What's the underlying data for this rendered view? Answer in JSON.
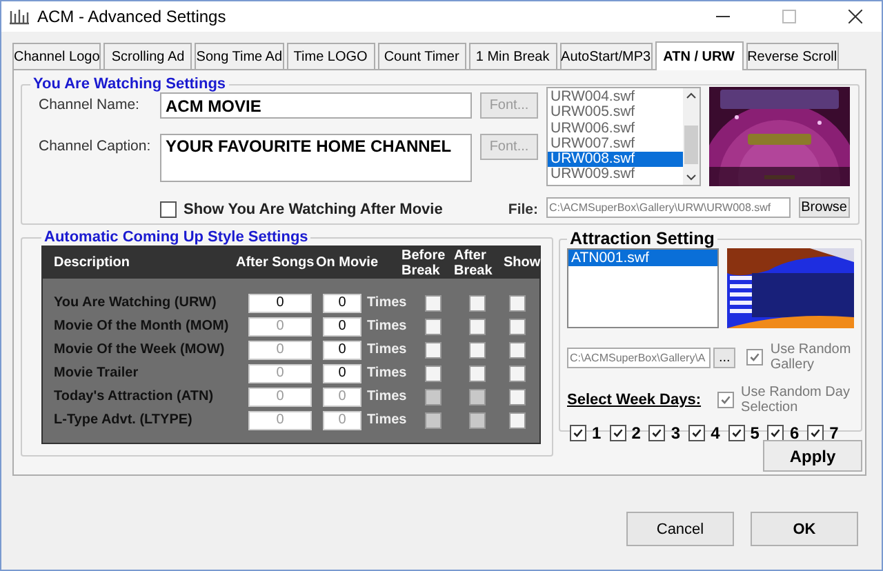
{
  "window": {
    "title": "ACM - Advanced Settings"
  },
  "tabs": [
    {
      "label": "Channel Logo",
      "selected": false
    },
    {
      "label": "Scrolling Ad",
      "selected": false
    },
    {
      "label": "Song Time Ad",
      "selected": false
    },
    {
      "label": "Time LOGO",
      "selected": false
    },
    {
      "label": "Count Timer",
      "selected": false
    },
    {
      "label": "1 Min Break",
      "selected": false
    },
    {
      "label": "AutoStart/MP3",
      "selected": false
    },
    {
      "label": "ATN / URW",
      "selected": true
    },
    {
      "label": "Reverse Scroll",
      "selected": false
    }
  ],
  "watching": {
    "title": "You Are Watching Settings",
    "channel_name": {
      "label": "Channel Name:",
      "value": "ACM MOVIE"
    },
    "channel_caption": {
      "label": "Channel Caption:",
      "value": "YOUR FAVOURITE HOME CHANNEL"
    },
    "font_buttons": [
      {
        "label": "Font...",
        "disabled": true
      },
      {
        "label": "Font...",
        "disabled": true
      }
    ],
    "show_after_movie": {
      "label": "Show You Are Watching After Movie",
      "checked": false
    },
    "files": [
      {
        "name": "URW004.swf",
        "selected": false
      },
      {
        "name": "URW005.swf",
        "selected": false
      },
      {
        "name": "URW006.swf",
        "selected": false
      },
      {
        "name": "URW007.swf",
        "selected": false
      },
      {
        "name": "URW008.swf",
        "selected": true
      },
      {
        "name": "URW009.swf",
        "selected": false
      }
    ],
    "file": {
      "label": "File:",
      "value": "C:\\ACMSuperBox\\Gallery\\URW\\URW008.swf",
      "disabled": true
    },
    "browse": "Browse"
  },
  "coming_up": {
    "title": "Automatic Coming Up Style Settings",
    "columns": [
      "Description",
      "After Songs",
      "On Movie",
      "Before Break",
      "After Break",
      "Show"
    ],
    "rows": [
      {
        "description": "You Are Watching (URW)",
        "after_songs": {
          "value": "0",
          "disabled": false
        },
        "on_movie": {
          "value": "0",
          "disabled": false
        },
        "unit": "Times",
        "before_break": {
          "checked": false,
          "disabled": false
        },
        "after_break": {
          "checked": false,
          "disabled": false
        },
        "show": {
          "checked": false,
          "disabled": false
        }
      },
      {
        "description": "Movie Of the Month (MOM)",
        "after_songs": {
          "value": "0",
          "disabled": true
        },
        "on_movie": {
          "value": "0",
          "disabled": false
        },
        "unit": "Times",
        "before_break": {
          "checked": false,
          "disabled": false
        },
        "after_break": {
          "checked": false,
          "disabled": false
        },
        "show": {
          "checked": false,
          "disabled": false
        }
      },
      {
        "description": "Movie Of the Week (MOW)",
        "after_songs": {
          "value": "0",
          "disabled": true
        },
        "on_movie": {
          "value": "0",
          "disabled": false
        },
        "unit": "Times",
        "before_break": {
          "checked": false,
          "disabled": false
        },
        "after_break": {
          "checked": false,
          "disabled": false
        },
        "show": {
          "checked": false,
          "disabled": false
        }
      },
      {
        "description": "Movie Trailer",
        "after_songs": {
          "value": "0",
          "disabled": true
        },
        "on_movie": {
          "value": "0",
          "disabled": false
        },
        "unit": "Times",
        "before_break": {
          "checked": false,
          "disabled": false
        },
        "after_break": {
          "checked": false,
          "disabled": false
        },
        "show": {
          "checked": false,
          "disabled": false
        }
      },
      {
        "description": "Today's Attraction (ATN)",
        "after_songs": {
          "value": "0",
          "disabled": true
        },
        "on_movie": {
          "value": "0",
          "disabled": true
        },
        "unit": "Times",
        "before_break": {
          "checked": false,
          "disabled": true
        },
        "after_break": {
          "checked": false,
          "disabled": true
        },
        "show": {
          "checked": false,
          "disabled": false
        }
      },
      {
        "description": "L-Type Advt. (LTYPE)",
        "after_songs": {
          "value": "0",
          "disabled": true
        },
        "on_movie": {
          "value": "0",
          "disabled": true
        },
        "unit": "Times",
        "before_break": {
          "checked": false,
          "disabled": true
        },
        "after_break": {
          "checked": false,
          "disabled": true
        },
        "show": {
          "checked": false,
          "disabled": false
        }
      }
    ]
  },
  "attraction": {
    "title": "Attraction Setting",
    "files": [
      {
        "name": "ATN001.swf",
        "selected": true
      }
    ],
    "path": {
      "value": "C:\\ACMSuperBox\\Gallery\\A",
      "disabled": true
    },
    "browse": "...",
    "random_gallery": {
      "label": "Use Random Gallery",
      "checked": true,
      "disabled": true
    },
    "week_days_label": "Select Week Days:",
    "random_day": {
      "label": "Use Random Day Selection",
      "checked": true,
      "disabled": true
    },
    "days": [
      {
        "label": "1",
        "checked": true
      },
      {
        "label": "2",
        "checked": true
      },
      {
        "label": "3",
        "checked": true
      },
      {
        "label": "4",
        "checked": true
      },
      {
        "label": "5",
        "checked": true
      },
      {
        "label": "6",
        "checked": true
      },
      {
        "label": "7",
        "checked": true
      }
    ]
  },
  "apply": "Apply",
  "buttons": [
    "Cancel",
    "OK"
  ]
}
